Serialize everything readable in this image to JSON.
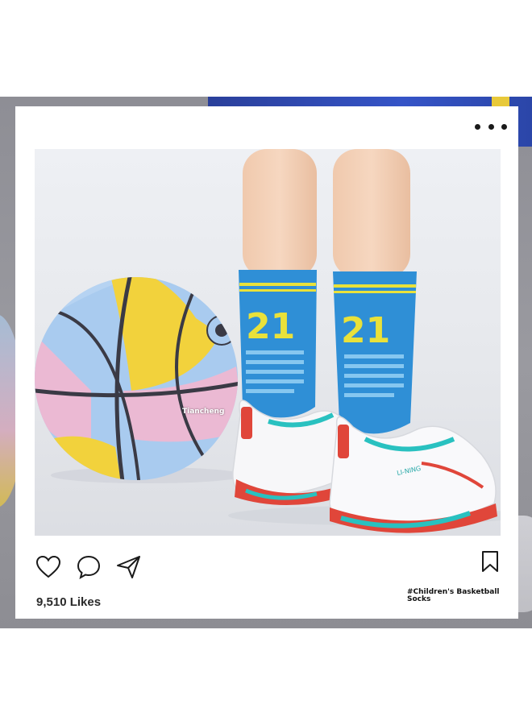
{
  "post": {
    "image_watermark": "Tiancheng",
    "likes_text": "9,510 Likes",
    "caption": "#Children's Basketball Socks",
    "sock_number": "21",
    "shoe_brand": "LI-NING"
  },
  "icons": {
    "more": "more-options-icon",
    "like": "heart-icon",
    "comment": "comment-icon",
    "share": "send-icon",
    "save": "bookmark-icon"
  },
  "colors": {
    "sock_blue": "#2f8fd6",
    "sock_yellow": "#e9e13a",
    "ball_yellow": "#f2d23c",
    "ball_blue": "#a9cbef",
    "ball_pink": "#ebb9d3",
    "shoe_accent": "#29c1c0",
    "shoe_red": "#e0463a"
  }
}
